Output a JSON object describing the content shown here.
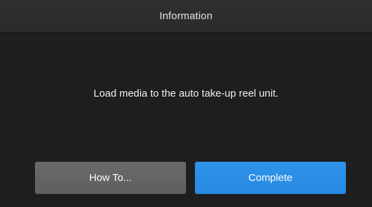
{
  "dialog": {
    "title": "Information",
    "message": "Load media to the auto take-up reel unit.",
    "buttons": {
      "howto_label": "How To...",
      "complete_label": "Complete"
    }
  },
  "colors": {
    "background": "#1e1e1e",
    "header": "#2d2d2d",
    "secondary_button": "#656565",
    "primary_button": "#2b8ee6",
    "text": "#ffffff"
  }
}
